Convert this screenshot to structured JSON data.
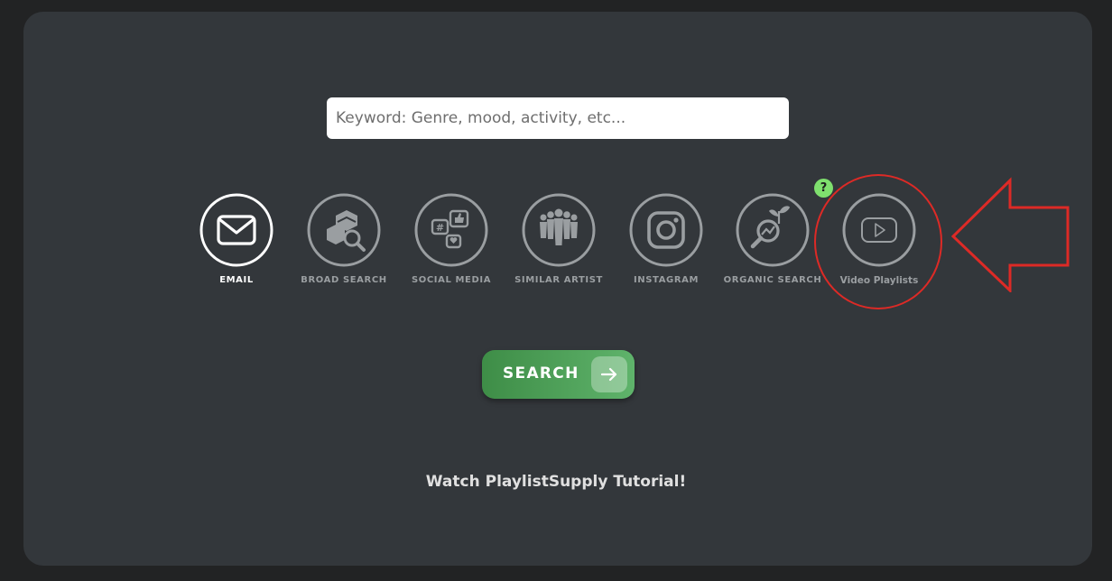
{
  "search": {
    "placeholder": "Keyword: Genre, mood, activity, etc..."
  },
  "modes": [
    {
      "label": "EMAIL",
      "icon": "envelope-icon",
      "active": true
    },
    {
      "label": "BROAD SEARCH",
      "icon": "cubes-magnifier-icon",
      "active": false
    },
    {
      "label": "SOCIAL MEDIA",
      "icon": "social-bubbles-icon",
      "active": false
    },
    {
      "label": "SIMILAR ARTIST",
      "icon": "people-group-icon",
      "active": false
    },
    {
      "label": "INSTAGRAM",
      "icon": "instagram-icon",
      "active": false
    },
    {
      "label": "ORGANIC SEARCH",
      "icon": "plant-magnifier-icon",
      "active": false
    },
    {
      "label": "Video Playlists",
      "icon": "play-icon",
      "active": false
    }
  ],
  "help_badge": "?",
  "search_button": {
    "label": "SEARCH"
  },
  "tutorial_link": "Watch PlaylistSupply Tutorial!",
  "colors": {
    "background": "#222324",
    "panel": "#33373b",
    "icon_inactive": "#9a9ea1",
    "icon_active": "#ffffff",
    "button_green": "#4fa25a",
    "badge_green": "#7fe06e",
    "annotation_red": "#dd2a26"
  }
}
